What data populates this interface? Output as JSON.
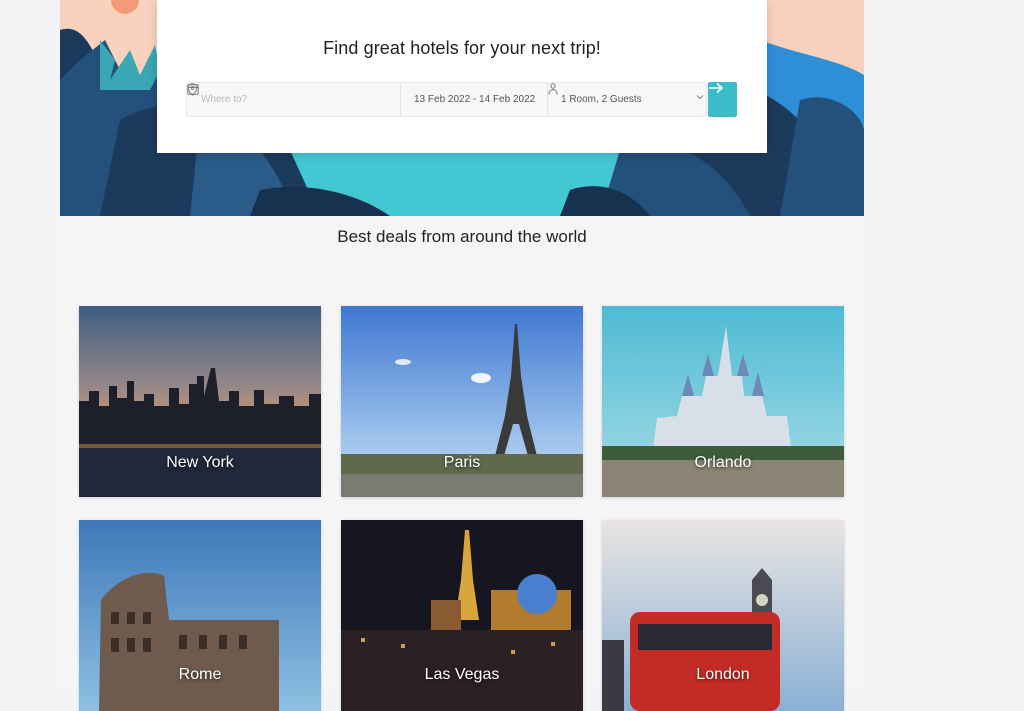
{
  "search": {
    "title": "Find great hotels for your next trip!",
    "where_placeholder": "Where to?",
    "dates": "13 Feb 2022 - 14 Feb 2022",
    "guests": "1 Room, 2 Guests"
  },
  "deals": {
    "title": "Best deals from around the world",
    "cities": [
      {
        "name": "New York"
      },
      {
        "name": "Paris"
      },
      {
        "name": "Orlando"
      },
      {
        "name": "Rome"
      },
      {
        "name": "Las Vegas"
      },
      {
        "name": "London"
      }
    ]
  },
  "colors": {
    "accent": "#3cbbc8",
    "hero_teal": "#43c7d3",
    "hero_navy": "#1c3a5c",
    "hero_peach": "#f8d2bc"
  }
}
